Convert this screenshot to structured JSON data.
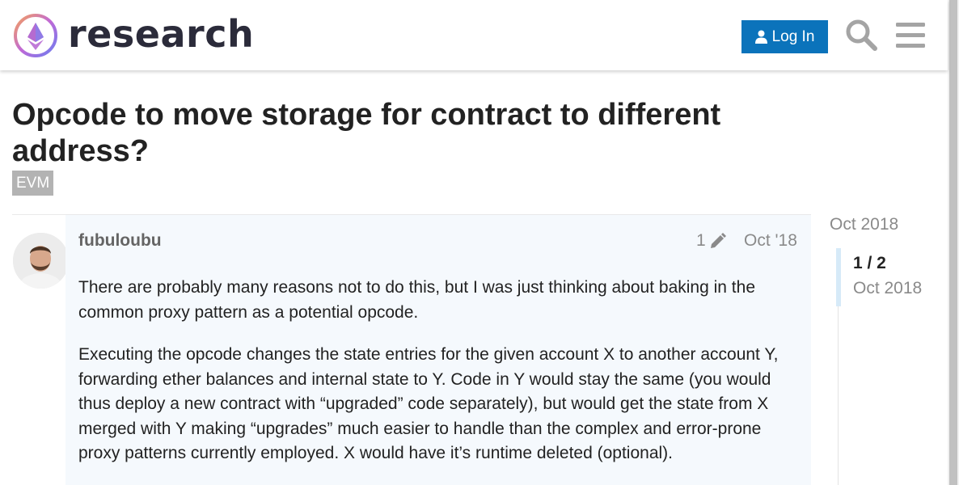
{
  "header": {
    "logo_text": "research",
    "login_label": "Log In",
    "search_icon": "search-icon",
    "menu_icon": "hamburger-menu-icon",
    "accent_color": "#0b73bb"
  },
  "topic": {
    "title": "Opcode to move storage for contract to different address?",
    "tag": "EVM"
  },
  "post": {
    "username": "fubuloubu",
    "edit_count": "1",
    "date": "Oct '18",
    "paragraphs": [
      "There are probably many reasons not to do this, but I was just thinking about baking in the common proxy pattern as a potential opcode.",
      "Executing the opcode changes the state entries for the given account X to another account Y, forwarding ether balances and internal state to Y. Code in Y would stay the same (you would thus deploy a new contract with “upgraded” code separately), but would get the state from X merged with Y making “upgrades” much easier to handle than the complex and error-prone proxy patterns currently employed. X would have it’s runtime deleted (optional)."
    ]
  },
  "timeline": {
    "start_date": "Oct 2018",
    "position": "1 / 2",
    "current_date": "Oct 2018"
  }
}
